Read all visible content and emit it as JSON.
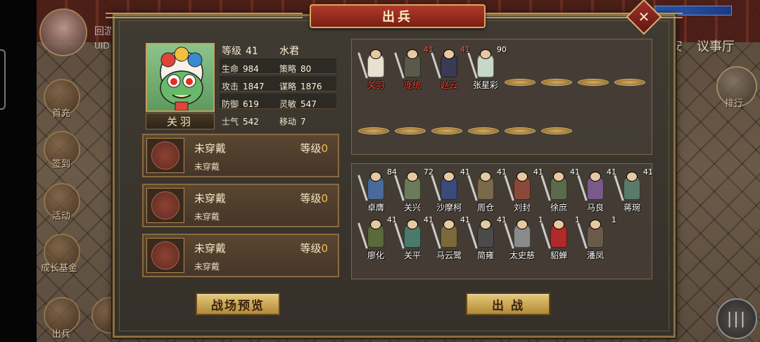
{
  "background": {
    "huiyou_label": "回游",
    "uid_label": "UID",
    "side_menu": [
      {
        "label": "首充",
        "icon": "gift-icon"
      },
      {
        "label": "签到",
        "icon": "checkin-icon"
      },
      {
        "label": "活动",
        "icon": "event-icon"
      },
      {
        "label": "成长基金",
        "icon": "fund-icon"
      },
      {
        "label": "出兵",
        "icon": "deploy-icon"
      }
    ],
    "right_labels": [
      "安",
      "议事厅"
    ],
    "rank_label": "排行"
  },
  "dialog": {
    "title": "出兵",
    "close_symbol": "✕"
  },
  "hero": {
    "name": "关羽",
    "portrait_icon": "lion-dance-mascot-icon",
    "stats": [
      {
        "label": "等级",
        "value": "41"
      },
      {
        "label": "",
        "value": "水君"
      },
      {
        "label": "生命",
        "value": "984"
      },
      {
        "label": "策略",
        "value": "80"
      },
      {
        "label": "攻击",
        "value": "1847"
      },
      {
        "label": "谋略",
        "value": "1876"
      },
      {
        "label": "防御",
        "value": "619"
      },
      {
        "label": "灵敏",
        "value": "547"
      },
      {
        "label": "士气",
        "value": "542"
      },
      {
        "label": "移动",
        "value": "7"
      }
    ]
  },
  "equipment": [
    {
      "title": "未穿戴",
      "subtitle": "未穿戴",
      "level_label": "等级",
      "level": "0"
    },
    {
      "title": "未穿戴",
      "subtitle": "未穿戴",
      "level_label": "等级",
      "level": "0"
    },
    {
      "title": "未穿戴",
      "subtitle": "未穿戴",
      "level_label": "等级",
      "level": "0"
    }
  ],
  "buttons": {
    "preview": "战场预览",
    "deploy": "出 战"
  },
  "formation": {
    "deployed": [
      {
        "name": "关羽",
        "level": "",
        "color": "#e8e0d0",
        "selected": true
      },
      {
        "name": "庞统",
        "level": "41",
        "color": "#5a5a4a",
        "selected": true
      },
      {
        "name": "赵云",
        "level": "41",
        "color": "#3a3a52",
        "selected": true
      },
      {
        "name": "张星彩",
        "level": "90",
        "color": "#c8d8c8",
        "selected": false
      }
    ]
  },
  "roster": [
    {
      "name": "卓膺",
      "level": "84",
      "color": "#4a6a9a"
    },
    {
      "name": "关兴",
      "level": "72",
      "color": "#6a7a5a"
    },
    {
      "name": "沙摩柯",
      "level": "41",
      "color": "#3a4a7a"
    },
    {
      "name": "周仓",
      "level": "41",
      "color": "#7a6a4a"
    },
    {
      "name": "刘封",
      "level": "41",
      "color": "#8a4a3a"
    },
    {
      "name": "徐庶",
      "level": "41",
      "color": "#5a6a4a"
    },
    {
      "name": "马良",
      "level": "41",
      "color": "#7a5a8a"
    },
    {
      "name": "蒋琬",
      "level": "41",
      "color": "#5a7a6a"
    },
    {
      "name": "廖化",
      "level": "41",
      "color": "#5a6a3a"
    },
    {
      "name": "关平",
      "level": "41",
      "color": "#4a7a6a"
    },
    {
      "name": "马云鹭",
      "level": "41",
      "color": "#7a6a3a"
    },
    {
      "name": "简雍",
      "level": "41",
      "color": "#4a4a4a"
    },
    {
      "name": "太史慈",
      "level": "1",
      "color": "#8a8a8a"
    },
    {
      "name": "貂蝉",
      "level": "1",
      "color": "#b02a2a"
    },
    {
      "name": "潘凤",
      "level": "1",
      "color": "#6a5a4a"
    }
  ]
}
